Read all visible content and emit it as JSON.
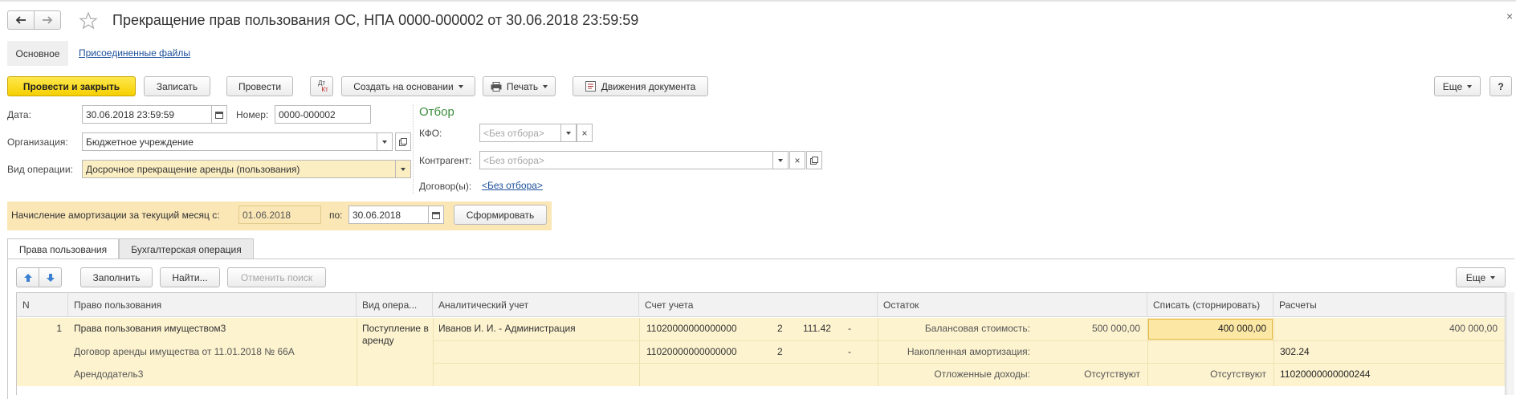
{
  "window": {
    "title": "Прекращение прав пользования ОС, НПА 0000-000002 от 30.06.2018 23:59:59",
    "close_glyph": "×"
  },
  "nav": {
    "tab_main": "Основное",
    "tab_files": "Присоединенные файлы"
  },
  "toolbar": {
    "post_close": "Провести и закрыть",
    "write": "Записать",
    "post": "Провести",
    "dt_kt_top": "Дт",
    "dt_kt_bottom": "Кт",
    "create_based": "Создать на основании",
    "print": "Печать",
    "movements": "Движения документа",
    "more": "Еще",
    "help": "?"
  },
  "form": {
    "date_label": "Дата:",
    "date_value": "30.06.2018 23:59:59",
    "number_label": "Номер:",
    "number_value": "0000-000002",
    "org_label": "Организация:",
    "org_value": "Бюджетное учреждение",
    "op_label": "Вид операции:",
    "op_value": "Досрочное прекращение аренды (пользования)"
  },
  "filter": {
    "title": "Отбор",
    "kfo_label": "КФО:",
    "kfo_placeholder": "<Без отбора>",
    "contractor_label": "Контрагент:",
    "contractor_placeholder": "<Без отбора>",
    "contracts_label": "Договор(ы):",
    "contracts_link": "<Без отбора>"
  },
  "amort": {
    "label": "Начисление амортизации за текущий месяц с:",
    "from": "01.06.2018",
    "to_label": "по:",
    "to": "30.06.2018",
    "generate": "Сформировать"
  },
  "tabs": {
    "rights": "Права пользования",
    "accounting": "Бухгалтерская операция"
  },
  "table_toolbar": {
    "fill": "Заполнить",
    "find": "Найти...",
    "cancel_search": "Отменить поиск",
    "more": "Еще"
  },
  "table": {
    "headers": [
      "N",
      "Право пользования",
      "Вид опера...",
      "Аналитический учет",
      "Счет учета",
      "Остаток",
      "Списать (сторнировать)",
      "Расчеты"
    ],
    "row": {
      "n": "1",
      "right_1": "Права пользования имуществом3",
      "right_2": "Договор аренды имущества от 11.01.2018 № 66А",
      "right_3": "Арендодатель3",
      "op_type": "Поступление в аренду",
      "analytics": "Иванов И. И. - Администрация",
      "acc_1": "11020000000000000",
      "acc_1_kfo": "2",
      "acc_1_kosgu": "111.42",
      "acc_1_dash": "-",
      "acc_2": "11020000000000000",
      "acc_2_kfo": "2",
      "acc_2_dash": "-",
      "rem_1_label": "Балансовая стоимость:",
      "rem_1_value": "500 000,00",
      "rem_2_label": "Накопленная амортизация:",
      "rem_3_label": "Отложенные доходы:",
      "rem_3_value": "Отсутствуют",
      "writeoff_1": "400 000,00",
      "writeoff_3": "Отсутствуют",
      "calc_1": "400 000,00",
      "calc_2": "302.24",
      "calc_3": "11020000000000244"
    }
  },
  "colors": {
    "accent_yellow": "#f5cf00",
    "row_yellow": "#fdf3cf",
    "link_blue": "#1c4f9b",
    "filter_green": "#3a8c3a"
  }
}
